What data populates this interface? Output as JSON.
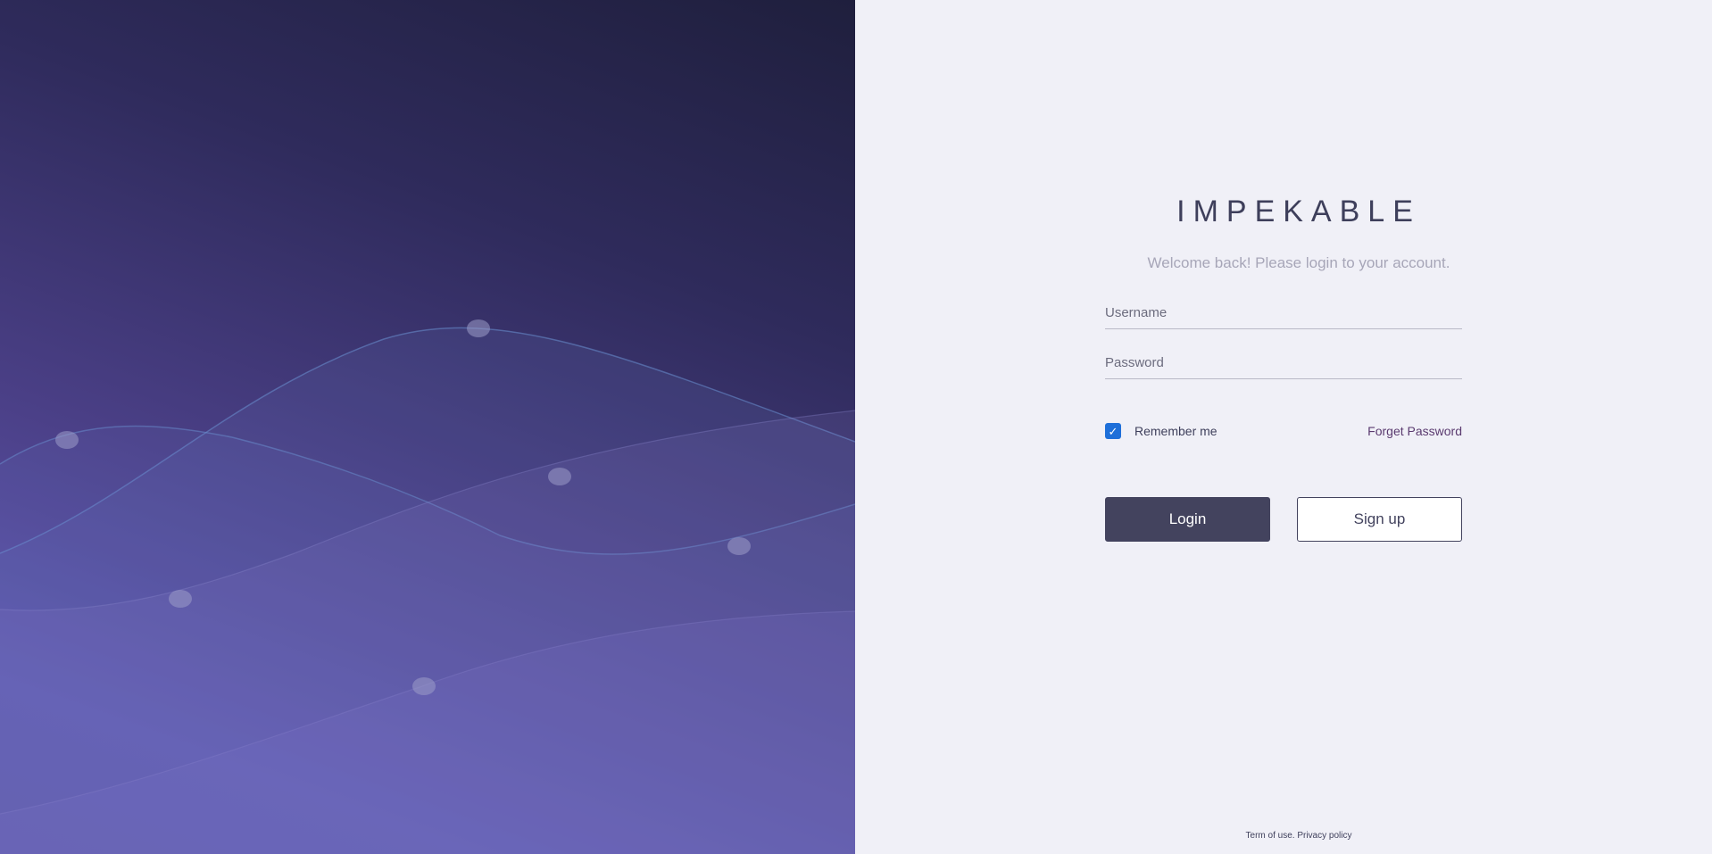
{
  "brand": {
    "name": "IMPEKABLE"
  },
  "login": {
    "welcome": "Welcome back! Please login to your account.",
    "username_placeholder": "Username",
    "password_placeholder": "Password",
    "username_value": "",
    "password_value": "",
    "remember_label": "Remember me",
    "remember_checked": true,
    "forgot_label": "Forget Password",
    "login_label": "Login",
    "signup_label": "Sign up"
  },
  "footer": {
    "terms": "Term of use.",
    "privacy": "Privacy policy"
  },
  "colors": {
    "accent": "#43435e",
    "checkbox": "#1e6fd9",
    "panel_dark": "#1f1f3d",
    "panel_light": "#5e55ad",
    "form_bg": "#f0f0f7"
  }
}
